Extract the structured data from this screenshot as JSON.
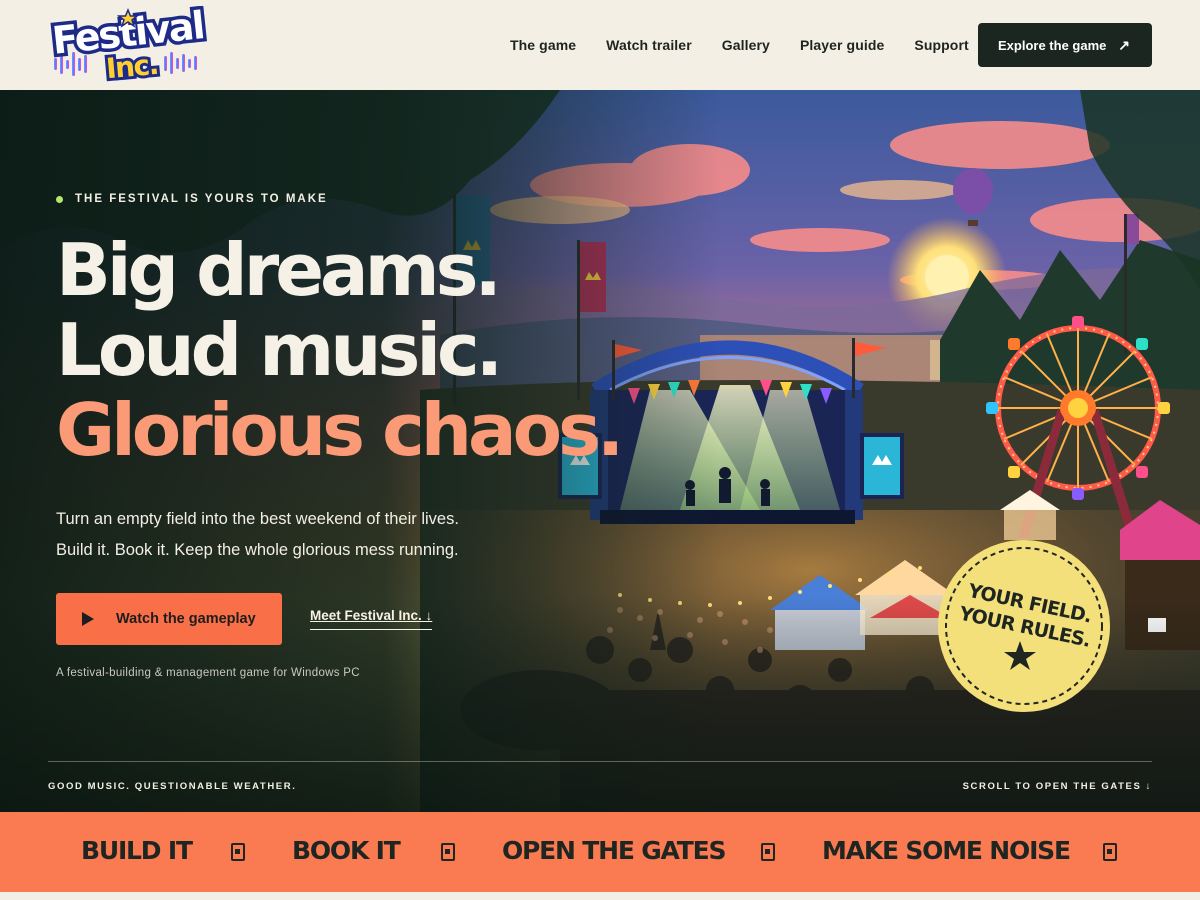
{
  "header": {
    "logo": {
      "line1": "Festival",
      "line2": "Inc."
    },
    "nav": [
      "The game",
      "Watch trailer",
      "Gallery",
      "Player guide",
      "Support"
    ],
    "cta": {
      "label": "Explore the game",
      "icon": "arrow-up-right-icon"
    }
  },
  "hero": {
    "eyebrow": "THE FESTIVAL IS YOURS TO MAKE",
    "headline": [
      "Big dreams.",
      "Loud music.",
      "Glorious chaos."
    ],
    "subtitle": [
      "Turn an empty field into the best weekend of their lives.",
      "Build it. Book it. Keep the whole glorious mess running."
    ],
    "primary_button": "Watch the gameplay",
    "secondary_link": "Meet Festival Inc. ↓",
    "platform_note": "A festival-building & management game for Windows PC",
    "badge": {
      "line1": "YOUR FIELD.",
      "line2": "YOUR RULES."
    },
    "footer_left": "GOOD MUSIC. QUESTIONABLE WEATHER.",
    "footer_right": "SCROLL TO OPEN THE GATES ↓"
  },
  "marquee": [
    "BUILD IT",
    "BOOK IT",
    "OPEN THE GATES",
    "MAKE SOME NOISE"
  ],
  "colors": {
    "accent": "#fa7a52",
    "dark": "#1b2621",
    "cream": "#f3efe4",
    "headline_accent": "#fb9a76",
    "badge": "#f4e07a",
    "eyebrow_dot": "#b8e86a"
  }
}
